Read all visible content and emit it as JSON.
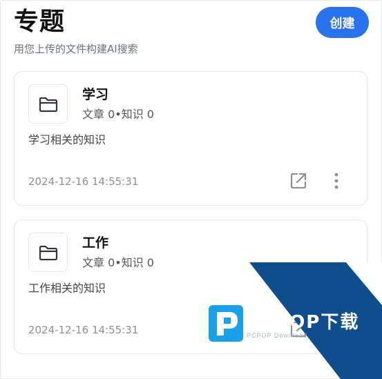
{
  "header": {
    "title": "专题",
    "subtitle": "用您上传的文件构建AI搜索",
    "create_label": "创建"
  },
  "topics": [
    {
      "name": "学习",
      "stats": "文章 0•知识 0",
      "description": "学习相关的知识",
      "created": "2024-12-16 14:55:31",
      "icon": "folder-icon"
    },
    {
      "name": "工作",
      "stats": "文章 0•知识 0",
      "description": "工作相关的知识",
      "created": "2024-12-16 14:55:31",
      "icon": "folder-icon"
    }
  ],
  "watermark": {
    "brand": "PCPOP下载",
    "sub": "PCPOP Download"
  },
  "colors": {
    "accent": "#2b73ee",
    "watermark_blue": "#0f4e8c"
  }
}
